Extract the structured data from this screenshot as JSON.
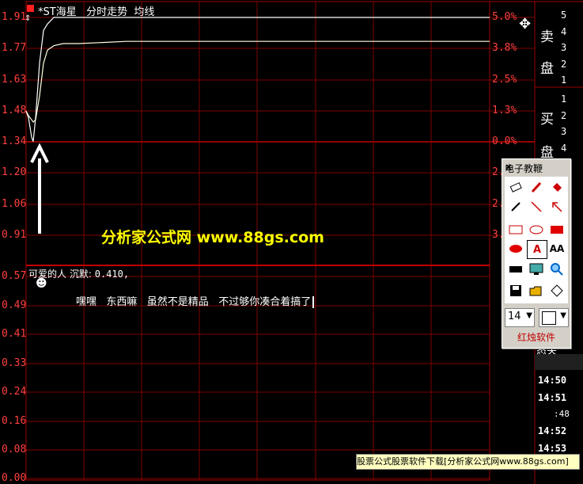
{
  "stock": {
    "marker_icon": "stock-marker-icon",
    "title": "*ST海星",
    "mode": "分时走势",
    "line_type": "均线"
  },
  "price_axis": [
    "1.91",
    "1.77",
    "1.63",
    "1.48",
    "1.34",
    "1.20",
    "1.06",
    "0.91"
  ],
  "pct_axis": [
    "5.0%",
    "3.8%",
    "2.5%",
    "1.3%",
    "0.0%",
    "2.",
    "2.",
    "3."
  ],
  "volume_axis": [
    "0.57",
    "0.49",
    "0.41",
    "0.33",
    "0.24",
    "0.16",
    "0.08",
    "0.00"
  ],
  "indicator": {
    "name": "可爱的人",
    "label": "沉默:",
    "value": "0.410,"
  },
  "watermark": "分析家公式网 www.88gs.com",
  "annotation_text": "嘿嘿   东西嘛   虽然不是精品   不过够你凑合着搞了",
  "side_panel": {
    "sell_label": [
      "卖",
      "盘"
    ],
    "buy_label": [
      "买",
      "盘"
    ],
    "sell_levels": [
      "5",
      "4",
      "3",
      "2",
      "1"
    ],
    "buy_levels": [
      "1",
      "2",
      "3",
      "4"
    ],
    "partial_label": "态关"
  },
  "times": [
    "14:50",
    "14:51",
    ":48",
    "14:52",
    "14:53"
  ],
  "toolbox": {
    "title": "电子教鞭",
    "close": "×",
    "font_size": "14",
    "brand": "红烛软件",
    "tools": [
      "eraser-icon",
      "pen-icon",
      "paint-bucket-icon",
      "pencil-icon",
      "line-icon",
      "arrow-icon",
      "rectangle-icon",
      "ellipse-icon",
      "filled-rect-icon",
      "filled-ellipse-icon",
      "text-icon",
      "text-size-icon",
      "black-bar-icon",
      "screen-icon",
      "zoom-icon",
      "save-icon",
      "open-icon",
      "diamond-icon"
    ]
  },
  "footer_banner": "股票公式股票软件下载[分析家公式网www.88gs.com]",
  "chart_data": {
    "type": "line",
    "price_range": [
      0.91,
      1.91
    ],
    "series": [
      {
        "values": [
          1.48,
          1.45,
          1.36,
          1.34,
          1.45,
          1.7,
          1.85,
          1.88,
          1.91,
          1.91,
          1.91,
          1.91,
          1.91,
          1.91,
          1.91,
          1.91,
          1.91,
          1.91,
          1.91,
          1.91,
          1.91,
          1.91,
          1.91,
          1.91,
          1.91
        ]
      },
      {
        "values": [
          1.48,
          1.46,
          1.44,
          1.43,
          1.44,
          1.55,
          1.7,
          1.76,
          1.78,
          1.79,
          1.79,
          1.795,
          1.8,
          1.8,
          1.8,
          1.8,
          1.8,
          1.8,
          1.8,
          1.8,
          1.8,
          1.8,
          1.8,
          1.8,
          1.8
        ]
      }
    ]
  }
}
